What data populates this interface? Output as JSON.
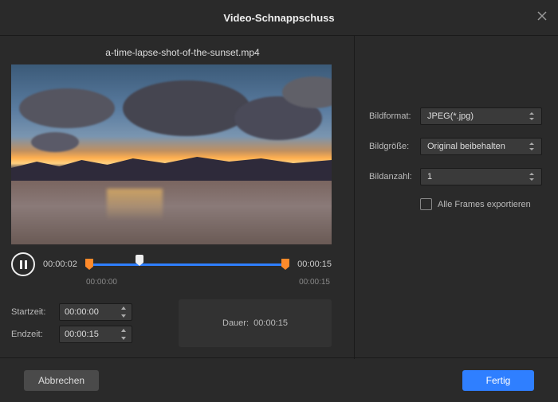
{
  "dialog": {
    "title": "Video-Schnappschuss",
    "filename": "a-time-lapse-shot-of-the-sunset.mp4"
  },
  "playback": {
    "current": "00:00:02",
    "duration": "00:00:15",
    "tick_start": "00:00:00",
    "tick_end": "00:00:15"
  },
  "time": {
    "start_label": "Startzeit:",
    "end_label": "Endzeit:",
    "start_value": "00:00:00",
    "end_value": "00:00:15",
    "duration_label": "Dauer:",
    "duration_value": "00:00:15"
  },
  "settings": {
    "format_label": "Bildformat:",
    "format_value": "JPEG(*.jpg)",
    "size_label": "Bildgröße:",
    "size_value": "Original beibehalten",
    "count_label": "Bildanzahl:",
    "count_value": "1",
    "export_all_label": "Alle Frames exportieren"
  },
  "buttons": {
    "cancel": "Abbrechen",
    "ok": "Fertig"
  }
}
